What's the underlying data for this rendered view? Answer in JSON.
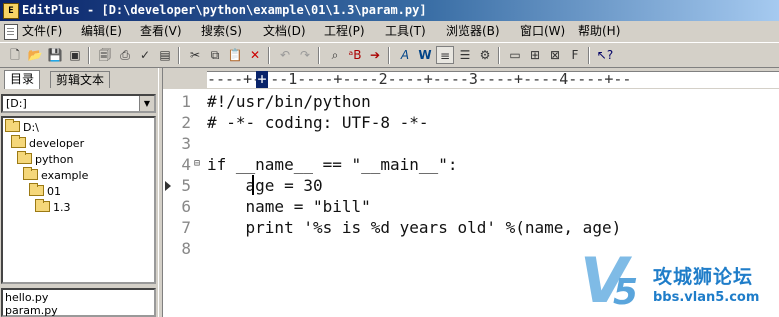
{
  "window": {
    "app_icon_text": "E",
    "title": "EditPlus - [D:\\developer\\python\\example\\01\\1.3\\param.py]"
  },
  "menu": [
    "文件(F)",
    "编辑(E)",
    "查看(V)",
    "搜索(S)",
    "文档(D)",
    "工程(P)",
    "工具(T)",
    "浏览器(B)",
    "窗口(W)",
    "帮助(H)"
  ],
  "toolbar": {
    "icons": [
      "new-file-icon",
      "open-folder-icon",
      "save-icon",
      "save-all-icon",
      "print-preview-icon",
      "print-icon",
      "spell-check-icon",
      "document-icon",
      "cut-icon",
      "copy-icon",
      "paste-icon",
      "delete-icon",
      "undo-icon",
      "redo-icon",
      "find-icon",
      "replace-icon",
      "goto-icon",
      "font-icon",
      "word-wrap-icon",
      "ruler-icon",
      "line-number-icon",
      "settings-icon",
      "panel-icon",
      "browser-icon",
      "help-icon"
    ]
  },
  "sidebar": {
    "tabs": [
      "目录",
      "剪辑文本"
    ],
    "drive": "[D:]",
    "tree": [
      {
        "label": "D:\\",
        "level": 0
      },
      {
        "label": "developer",
        "level": 1
      },
      {
        "label": "python",
        "level": 2
      },
      {
        "label": "example",
        "level": 3
      },
      {
        "label": "01",
        "level": 4
      },
      {
        "label": "1.3",
        "level": 5
      }
    ],
    "files": [
      "hello.py",
      "param.py"
    ]
  },
  "ruler": {
    "text": "----+----1----+----2----+----3----+----4----+--",
    "cursor_char": "+"
  },
  "editor": {
    "lines": [
      {
        "num": "1",
        "text": "#!/usr/bin/python"
      },
      {
        "num": "2",
        "text": "# -*- coding: UTF-8 -*-"
      },
      {
        "num": "3",
        "text": ""
      },
      {
        "num": "4",
        "text": "if __name__ == \"__main__\":"
      },
      {
        "num": "5",
        "text": "    age = 30"
      },
      {
        "num": "6",
        "text": "    name = \"bill\""
      },
      {
        "num": "7",
        "text": "    print '%s is %d years old' %(name, age)"
      },
      {
        "num": "8",
        "text": ""
      }
    ],
    "fold_marker": "⊟",
    "current_line": 5
  },
  "watermark": {
    "logo_letter": "V",
    "logo_digit": "5",
    "name": "攻城狮论坛",
    "url": "bbs.vlan5.com"
  }
}
